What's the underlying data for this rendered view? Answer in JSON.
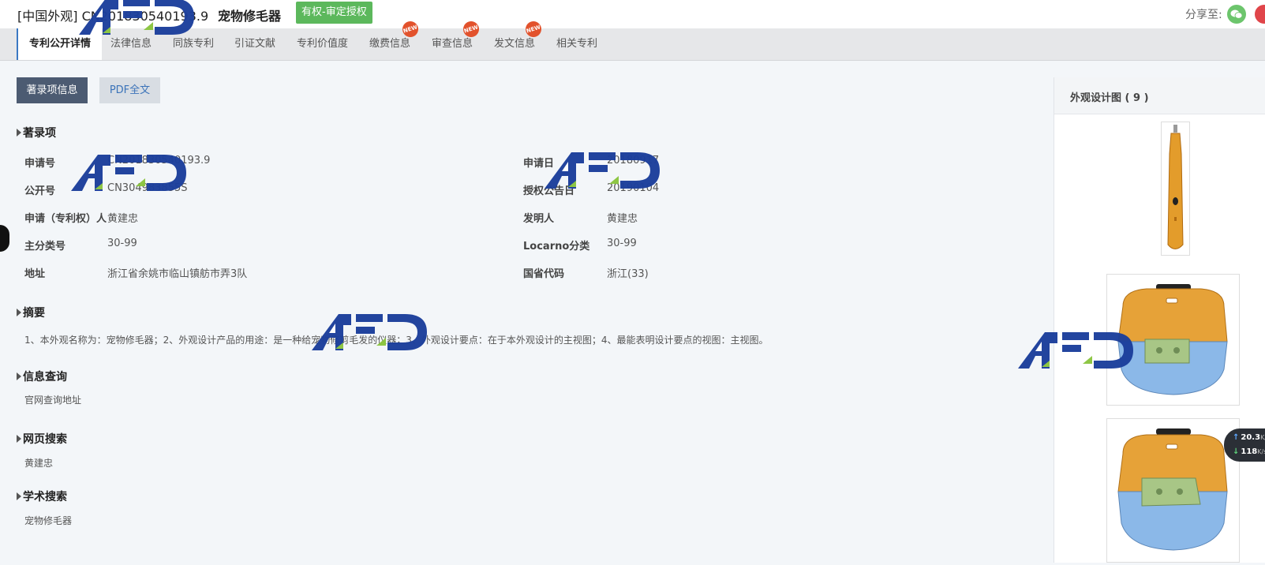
{
  "header": {
    "patent_title": "[中国外观] CN201830540193.9",
    "patent_name": "宠物修毛器",
    "status_badge": "有权-审定授权",
    "share_label": "分享至:"
  },
  "tabs": [
    {
      "label": "专利公开详情",
      "active": true,
      "new": false
    },
    {
      "label": "法律信息",
      "active": false,
      "new": false
    },
    {
      "label": "同族专利",
      "active": false,
      "new": false
    },
    {
      "label": "引证文献",
      "active": false,
      "new": false
    },
    {
      "label": "专利价值度",
      "active": false,
      "new": false
    },
    {
      "label": "缴费信息",
      "active": false,
      "new": true
    },
    {
      "label": "审查信息",
      "active": false,
      "new": true
    },
    {
      "label": "发文信息",
      "active": false,
      "new": true
    },
    {
      "label": "相关专利",
      "active": false,
      "new": false
    }
  ],
  "new_badge_text": "NEW",
  "buttons": {
    "bibliographic": "著录项信息",
    "pdf": "PDF全文"
  },
  "bibliographic": {
    "title": "著录项",
    "left_fields": [
      {
        "label": "申请号",
        "value": "CN201830540193.9"
      },
      {
        "label": "公开号",
        "value": "CN304983855S"
      },
      {
        "label": "申请（专利权）人",
        "value": "黄建忠"
      },
      {
        "label": "主分类号",
        "value": "30-99"
      },
      {
        "label": "地址",
        "value": "浙江省余姚市临山镇舫市弄3队"
      }
    ],
    "right_fields": [
      {
        "label": "申请日",
        "value": "20180917"
      },
      {
        "label": "授权公告日",
        "value": "20190104"
      },
      {
        "label": "发明人",
        "value": "黄建忠"
      },
      {
        "label": "Locarno分类",
        "value": "30-99"
      },
      {
        "label": "国省代码",
        "value": "浙江(33)"
      }
    ]
  },
  "abstract": {
    "title": "摘要",
    "text": "1、本外观名称为：宠物修毛器；2、外观设计产品的用途：是一种给宠物修剪毛发的仪器；3、外观设计要点：在于本外观设计的主视图；4、最能表明设计要点的视图：主视图。"
  },
  "info_query": {
    "title": "信息查询",
    "link": "官网查询地址"
  },
  "web_search": {
    "title": "网页搜索",
    "text": "黄建忠"
  },
  "academic_search": {
    "title": "学术搜索",
    "text": "宠物修毛器"
  },
  "right_panel": {
    "title": "外观设计图 ( 9 )"
  },
  "speed_widget": {
    "upload": "20.3",
    "download": "118",
    "unit": "K/s"
  },
  "colors": {
    "badge_green": "#5cb85c",
    "new_badge": "#e2522c",
    "tab_active_border": "#3a78c3",
    "watermark_blue": "#1c3f9c",
    "watermark_green": "#8bc53f"
  }
}
